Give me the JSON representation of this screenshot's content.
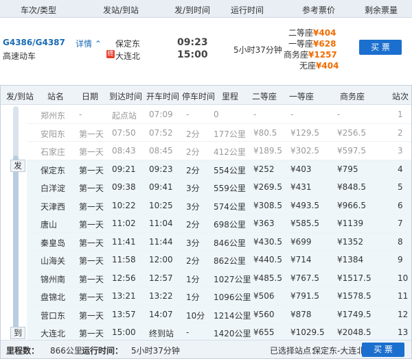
{
  "header": {
    "col_train": "车次/类型",
    "col_station": "发站/到站",
    "col_time": "发/到时间",
    "col_duration": "运行时间",
    "col_price": "参考票价",
    "col_remain": "剩余票量"
  },
  "train": {
    "code": "G4386/G4387",
    "detail": "详情",
    "type": "高速动车",
    "from": "保定东",
    "to": "大连北",
    "end_mark": "终",
    "depart": "09:23",
    "arrive": "15:00",
    "duration": "5小时37分钟",
    "prices": [
      {
        "label": "二等座",
        "value": "¥404"
      },
      {
        "label": "一等座",
        "value": "¥628"
      },
      {
        "label": "商务座",
        "value": "¥1257"
      },
      {
        "label": "无座",
        "value": "¥404"
      }
    ],
    "book": "买 票"
  },
  "stops_header": {
    "from_to": "发/到站",
    "station": "站名",
    "date": "日期",
    "arr": "到达时间",
    "dep": "开车时间",
    "stay": "停车时间",
    "mileage": "里程",
    "second": "二等座",
    "first": "一等座",
    "business": "商务座",
    "num": "站次"
  },
  "tags": {
    "depart": "发",
    "arrive": "到"
  },
  "stops": [
    {
      "name": "郑州东",
      "date": "-",
      "arr": "起点站",
      "dep": "07:09",
      "stay": "-",
      "km": "0",
      "s2": "-",
      "s1": "-",
      "sb": "-",
      "no": "1"
    },
    {
      "name": "安阳东",
      "date": "第一天",
      "arr": "07:50",
      "dep": "07:52",
      "stay": "2分",
      "km": "177公里",
      "s2": "¥80.5",
      "s1": "¥129.5",
      "sb": "¥256.5",
      "no": "2"
    },
    {
      "name": "石家庄",
      "date": "第一天",
      "arr": "08:43",
      "dep": "08:45",
      "stay": "2分",
      "km": "412公里",
      "s2": "¥189.5",
      "s1": "¥302.5",
      "sb": "¥597.5",
      "no": "3"
    },
    {
      "name": "保定东",
      "date": "第一天",
      "arr": "09:21",
      "dep": "09:23",
      "stay": "2分",
      "km": "554公里",
      "s2": "¥252",
      "s1": "¥403",
      "sb": "¥795",
      "no": "4"
    },
    {
      "name": "白洋淀",
      "date": "第一天",
      "arr": "09:38",
      "dep": "09:41",
      "stay": "3分",
      "km": "559公里",
      "s2": "¥269.5",
      "s1": "¥431",
      "sb": "¥848.5",
      "no": "5"
    },
    {
      "name": "天津西",
      "date": "第一天",
      "arr": "10:22",
      "dep": "10:25",
      "stay": "3分",
      "km": "574公里",
      "s2": "¥308.5",
      "s1": "¥493.5",
      "sb": "¥966.5",
      "no": "6"
    },
    {
      "name": "唐山",
      "date": "第一天",
      "arr": "11:02",
      "dep": "11:04",
      "stay": "2分",
      "km": "698公里",
      "s2": "¥363",
      "s1": "¥585.5",
      "sb": "¥1139",
      "no": "7"
    },
    {
      "name": "秦皇岛",
      "date": "第一天",
      "arr": "11:41",
      "dep": "11:44",
      "stay": "3分",
      "km": "846公里",
      "s2": "¥430.5",
      "s1": "¥699",
      "sb": "¥1352",
      "no": "8"
    },
    {
      "name": "山海关",
      "date": "第一天",
      "arr": "11:58",
      "dep": "12:00",
      "stay": "2分",
      "km": "862公里",
      "s2": "¥440.5",
      "s1": "¥714",
      "sb": "¥1384",
      "no": "9"
    },
    {
      "name": "锦州南",
      "date": "第一天",
      "arr": "12:56",
      "dep": "12:57",
      "stay": "1分",
      "km": "1027公里",
      "s2": "¥485.5",
      "s1": "¥767.5",
      "sb": "¥1517.5",
      "no": "10"
    },
    {
      "name": "盘锦北",
      "date": "第一天",
      "arr": "13:21",
      "dep": "13:22",
      "stay": "1分",
      "km": "1096公里",
      "s2": "¥506",
      "s1": "¥791.5",
      "sb": "¥1578.5",
      "no": "11"
    },
    {
      "name": "营口东",
      "date": "第一天",
      "arr": "13:57",
      "dep": "14:07",
      "stay": "10分",
      "km": "1214公里",
      "s2": "¥560",
      "s1": "¥878",
      "sb": "¥1749.5",
      "no": "12"
    },
    {
      "name": "大连北",
      "date": "第一天",
      "arr": "15:00",
      "dep": "终到站",
      "stay": "-",
      "km": "1420公里",
      "s2": "¥655",
      "s1": "¥1029.5",
      "sb": "¥2048.5",
      "no": "13"
    }
  ],
  "summary": {
    "mileage_label": "里程数：",
    "mileage": "866公里",
    "time_label": "运行时间：",
    "time": "5小时37分钟",
    "selected_label": "已选择站点：",
    "selected": "保定东-大连北",
    "book": "买 票"
  }
}
